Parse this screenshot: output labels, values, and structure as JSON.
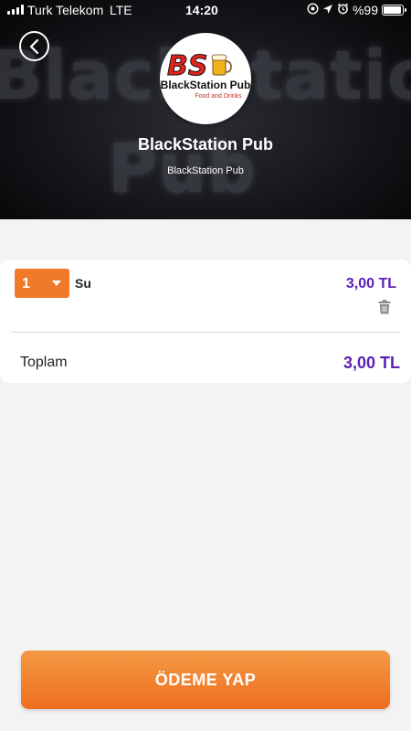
{
  "status_bar": {
    "carrier": "Turk Telekom",
    "network": "LTE",
    "time": "14:20",
    "battery": "%99",
    "battery_level": 0.99,
    "icons": [
      "location-lock-icon",
      "location-arrow-icon",
      "alarm-icon"
    ]
  },
  "header": {
    "back_icon": "chevron-left-icon",
    "venue_name": "BlackStation Pub",
    "venue_subtitle": "BlackStation Pub",
    "background_text": [
      "BlackStation",
      "Pub"
    ],
    "logo": {
      "title": "BlackStation Pub",
      "tagline": "Food and Drinks",
      "monogram": "BS"
    }
  },
  "cart": {
    "items": [
      {
        "quantity": "1",
        "name": "Su",
        "price": "3,00 TL"
      }
    ],
    "total_label": "Toplam",
    "total_value": "3,00 TL",
    "delete_icon": "trash-icon"
  },
  "actions": {
    "pay_label": "ÖDEME YAP"
  },
  "colors": {
    "accent_orange": "#f07a2a",
    "price_purple": "#5a1fb5",
    "background": "#f3f3f3"
  }
}
